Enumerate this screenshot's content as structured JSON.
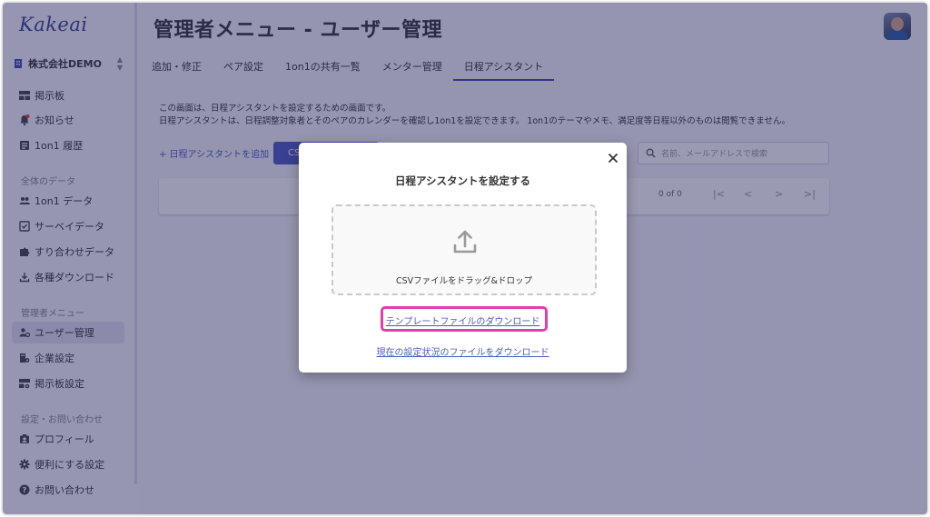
{
  "app": {
    "logo": "Kakeai"
  },
  "header": {
    "title": "管理者メニュー - ユーザー管理"
  },
  "sidebar": {
    "company": "株式会社DEMO",
    "items_top": [
      {
        "label": "掲示板",
        "icon": "board-icon"
      },
      {
        "label": "お知らせ",
        "icon": "bell-icon"
      },
      {
        "label": "1on1 履歴",
        "icon": "history-icon"
      }
    ],
    "section_data": "全体のデータ",
    "items_data": [
      {
        "label": "1on1 データ",
        "icon": "people-icon"
      },
      {
        "label": "サーベイデータ",
        "icon": "survey-icon"
      },
      {
        "label": "すり合わせデータ",
        "icon": "puzzle-icon"
      },
      {
        "label": "各種ダウンロード",
        "icon": "download-icon"
      }
    ],
    "section_admin": "管理者メニュー",
    "items_admin": [
      {
        "label": "ユーザー管理",
        "icon": "user-manage-icon"
      },
      {
        "label": "企業設定",
        "icon": "company-settings-icon"
      },
      {
        "label": "掲示板設定",
        "icon": "board-settings-icon"
      }
    ],
    "section_settings": "設定・お問い合わせ",
    "items_settings": [
      {
        "label": "プロフィール",
        "icon": "profile-icon"
      },
      {
        "label": "便利にする設定",
        "icon": "gear-icon"
      },
      {
        "label": "お問い合わせ",
        "icon": "help-icon"
      }
    ]
  },
  "tabs": [
    "追加・修正",
    "ペア設定",
    "1on1の共有一覧",
    "メンター管理",
    "日程アシスタント"
  ],
  "main": {
    "desc_line1": "この画面は、日程アシスタントを設定するための画面です。",
    "desc_line2": "日程アシスタントは、日程調整対象者とそのペアのカレンダーを確認し1on1を設定できます。 1on1のテーマやメモ、満足度等日程以外のものは閲覧できません。",
    "add_link": "+ 日程アシスタントを追加",
    "csv_button": "CS",
    "search_placeholder": "名前、メールアドレスで検索",
    "pager_text": "0 of 0",
    "pager_first": "|<",
    "pager_prev": "<",
    "pager_next": ">",
    "pager_last": ">|"
  },
  "modal": {
    "title": "日程アシスタントを設定する",
    "close": "×",
    "dropzone_text": "CSVファイルをドラッグ&ドロップ",
    "template_link": "テンプレートファイルのダウンロード",
    "current_link": "現在の設定状況のファイルをダウンロード"
  },
  "colors": {
    "accent": "#4c59c4",
    "highlight": "#e93ba7",
    "overlay": "#23235a"
  }
}
